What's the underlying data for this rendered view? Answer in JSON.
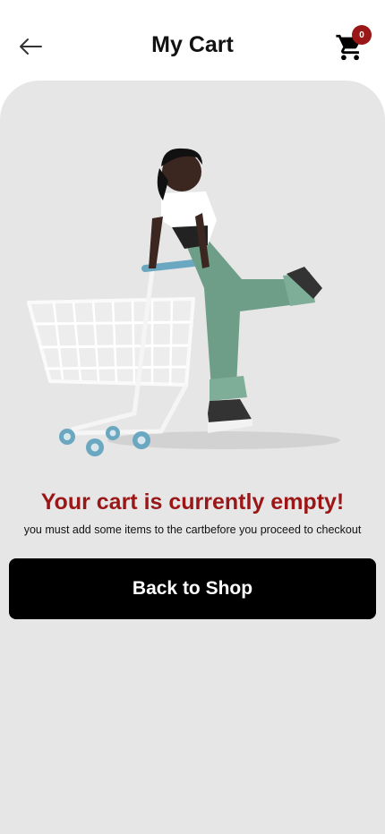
{
  "header": {
    "title": "My Cart",
    "back_icon": "arrow-left-icon",
    "cart_icon": "shopping-cart-icon",
    "cart_count": "0"
  },
  "empty_state": {
    "title": "Your cart is currently empty!",
    "subtitle": "you must add some items to the cartbefore you proceed to checkout",
    "button_label": "Back to Shop"
  },
  "colors": {
    "accent": "#9b1717",
    "panel_bg": "#e6e6e6",
    "button_bg": "#000000"
  }
}
